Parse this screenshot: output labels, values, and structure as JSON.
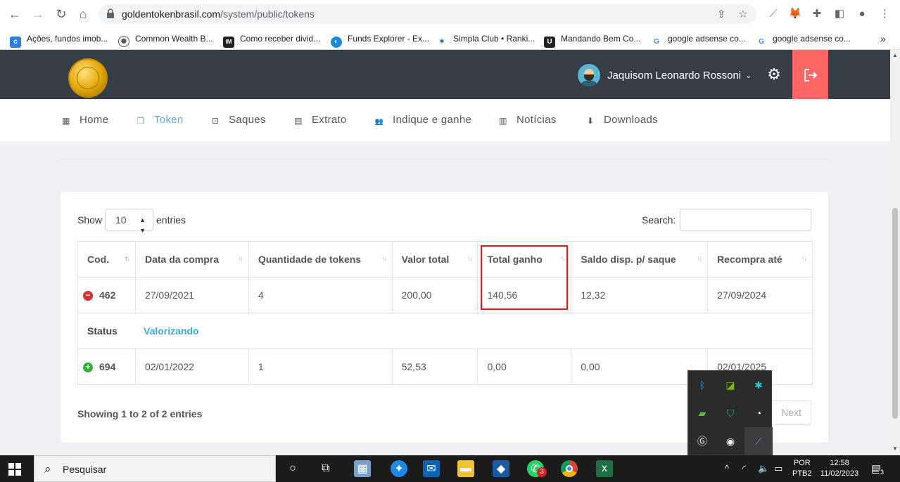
{
  "browser": {
    "url_host": "goldentokenbrasil.com",
    "url_path": "/system/public/tokens",
    "bookmarks": [
      {
        "label": "Ações, fundos imob...",
        "icon": "generic-favicon"
      },
      {
        "label": "Common Wealth B...",
        "icon": "chatgpt-favicon"
      },
      {
        "label": "Como receber divid...",
        "icon": "im-favicon",
        "mark": "IM"
      },
      {
        "label": "Funds Explorer - Ex...",
        "icon": "funds-explorer-favicon"
      },
      {
        "label": "Simpla Club • Ranki...",
        "icon": "simpla-favicon"
      },
      {
        "label": "Mandando Bem Co...",
        "icon": "u-favicon",
        "mark": "U"
      },
      {
        "label": "google adsense co...",
        "icon": "google-favicon",
        "mark": "G"
      },
      {
        "label": "google adsense co...",
        "icon": "google-favicon",
        "mark": "G"
      }
    ],
    "overflow": "»"
  },
  "header": {
    "user_name": "Jaquisom Leonardo Rossoni",
    "accent_logout": "#ff6767",
    "bg": "#363d45"
  },
  "menu": [
    {
      "label": "Home",
      "icon": "dashboard-icon",
      "glyph": "▦",
      "active": false
    },
    {
      "label": "Token",
      "icon": "copy-icon",
      "glyph": "❐",
      "active": true
    },
    {
      "label": "Saques",
      "icon": "money-icon",
      "glyph": "⊡",
      "active": false
    },
    {
      "label": "Extrato",
      "icon": "document-icon",
      "glyph": "▤",
      "active": false
    },
    {
      "label": "Indique e ganhe",
      "icon": "user-plus-icon",
      "glyph": "👥",
      "active": false
    },
    {
      "label": "Notícias",
      "icon": "news-icon",
      "glyph": "▥",
      "active": false
    },
    {
      "label": "Downloads",
      "icon": "download-icon",
      "glyph": "⬇",
      "active": false
    }
  ],
  "table": {
    "show_label": "Show",
    "length_value": "10",
    "entries_label": "entries",
    "search_label": "Search:",
    "columns": [
      "Cod.",
      "Data da compra",
      "Quantidade de tokens",
      "Valor total",
      "Total ganho",
      "Saldo disp. p/ saque",
      "Recompra até"
    ],
    "rows": [
      {
        "cod": "462",
        "data": "27/09/2021",
        "qtd": "4",
        "valor": "200,00",
        "ganho": "140,56",
        "saldo": "12,32",
        "recompra": "27/09/2024",
        "expanded": true
      },
      {
        "cod": "694",
        "data": "02/01/2022",
        "qtd": "1",
        "valor": "52,53",
        "ganho": "0,00",
        "saldo": "0,00",
        "recompra": "02/01/2025",
        "expanded": false
      }
    ],
    "child": {
      "status_label": "Status",
      "status_value": "Valorizando"
    },
    "info": "Showing 1 to 2 of 2 entries",
    "next_label": "Next"
  },
  "taskbar": {
    "search_placeholder": "Pesquisar",
    "whatsapp_badge": "3",
    "lang_top": "POR",
    "lang_bottom": "PTB2",
    "time": "12:58",
    "date": "11/02/2023",
    "notif_count": "3"
  }
}
